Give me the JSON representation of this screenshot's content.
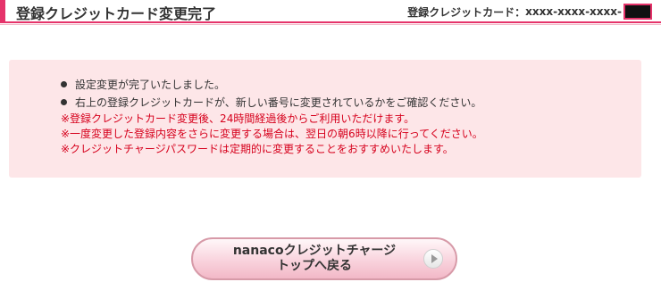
{
  "header": {
    "title": "登録クレジットカード変更完了",
    "card_label": "登録クレジットカード：",
    "card_number": "xxxx-xxxx-xxxx-"
  },
  "messages": {
    "bullets": [
      "設定変更が完了いたしました。",
      "右上の登録クレジットカードが、新しい番号に変更されているかをご確認ください。"
    ],
    "notes": [
      "※登録クレジットカード変更後、24時間経過後からご利用いただけます。",
      "※一度変更した登録内容をさらに変更する場合は、翌日の朝6時以降に行ってください。",
      "※クレジットチャージパスワードは定期的に変更することをおすすめいたします。"
    ]
  },
  "back_button": {
    "line1": "nanacoクレジットチャージ",
    "line2": "トップへ戻る"
  },
  "colors": {
    "accent": "#e5336a",
    "notice_bg": "#fde6e8",
    "note_text": "#d6001c"
  }
}
